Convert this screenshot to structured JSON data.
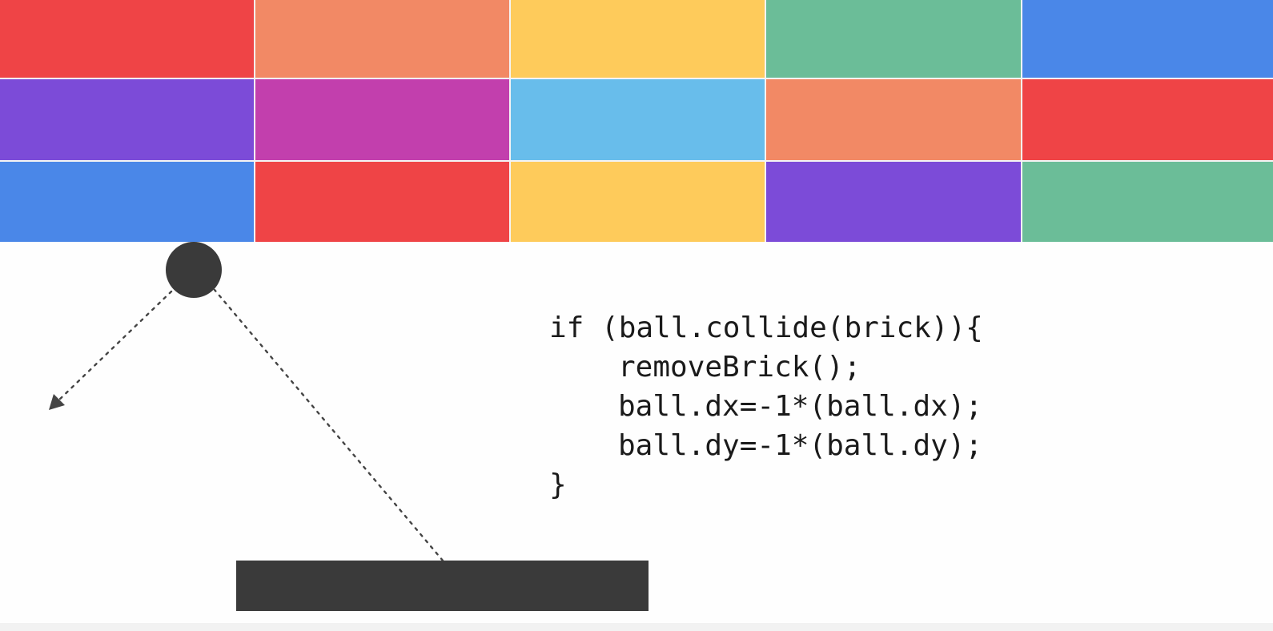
{
  "game": {
    "bricks": [
      [
        "#ef4446",
        "#f28965",
        "#fecb5b",
        "#6bbd98",
        "#4a87e8"
      ],
      [
        "#7c4bd8",
        "#c23fad",
        "#68bdeb",
        "#f28965",
        "#ef4446"
      ],
      [
        "#4a87e8",
        "#ef4446",
        "#fecb5b",
        "#7c4bd8",
        "#6bbd98"
      ]
    ],
    "ball_color": "#3a3a3a",
    "paddle_color": "#3a3a3a",
    "trajectory_color": "#444444"
  },
  "code": {
    "line1": "if (ball.collide(brick)){",
    "line2": "removeBrick();",
    "line3": "ball.dx=-1*(ball.dx);",
    "line4": "ball.dy=-1*(ball.dy);",
    "line5": "}"
  }
}
